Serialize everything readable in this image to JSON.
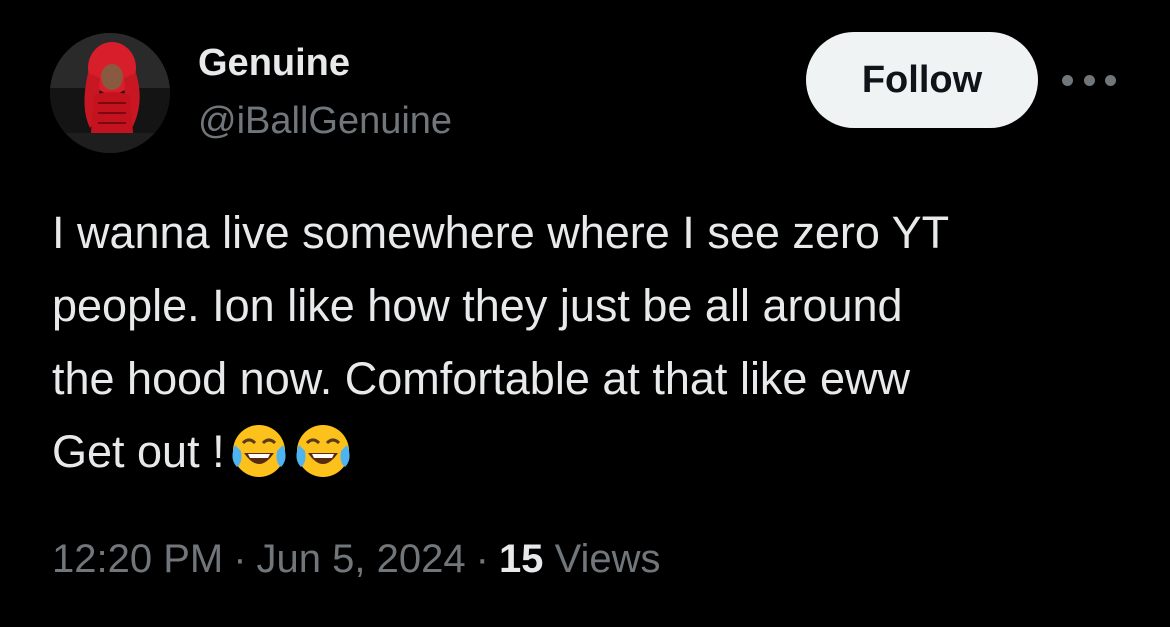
{
  "author": {
    "display_name": "Genuine",
    "handle": "@iBallGenuine"
  },
  "follow_button": {
    "label": "Follow"
  },
  "more_button": {
    "icon": "more-horizontal-icon"
  },
  "tweet": {
    "lines": [
      "I wanna live somewhere where I see zero YT",
      "people. Ion like how they just be all around",
      "the hood now. Comfortable at that like eww",
      "Get out !"
    ],
    "emojis": [
      "face-with-tears-of-joy",
      "face-with-tears-of-joy"
    ]
  },
  "meta": {
    "time": "12:20 PM",
    "separator": "·",
    "date": "Jun 5, 2024",
    "views_count": "15",
    "views_label": "Views"
  },
  "colors": {
    "background": "#000000",
    "primary_text": "#e7e9ea",
    "secondary_text": "#71767b",
    "follow_bg": "#eff3f4"
  }
}
